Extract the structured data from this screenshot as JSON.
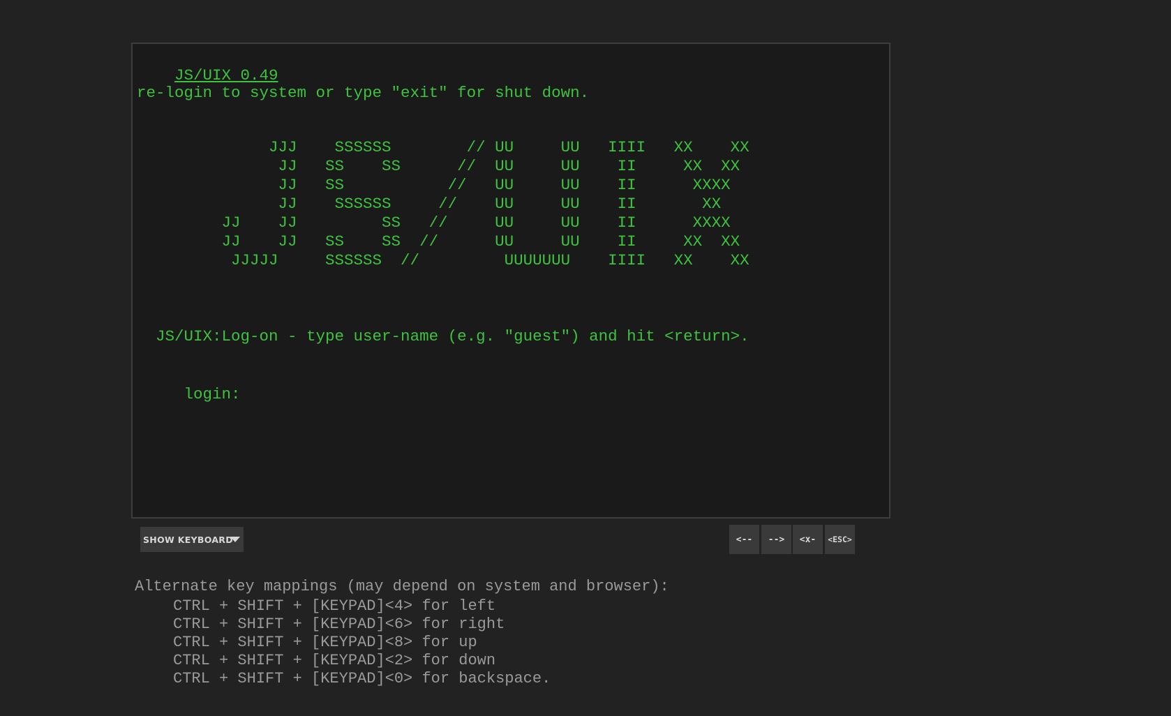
{
  "terminal": {
    "title": "JS/UIX 0.49",
    "relogin_message": "re-login to system or type \"exit\" for shut down.",
    "banner": [
      "              JJJ    SSSSSS        // UU     UU   IIII   XX    XX",
      "               JJ   SS    SS      //  UU     UU    II     XX  XX",
      "               JJ   SS           //   UU     UU    II      XXXX",
      "               JJ    SSSSSS     //    UU     UU    II       XX",
      "         JJ    JJ         SS   //     UU     UU    II      XXXX",
      "         JJ    JJ   SS    SS  //      UU     UU    II     XX  XX",
      "          JJJJJ     SSSSSS  //         UUUUUUU    IIII   XX    XX"
    ],
    "logon_hint": "  JS/UIX:Log-on - type user-name (e.g. \"guest\") and hit <return>.",
    "login_prompt": " login:"
  },
  "controls": {
    "show_keyboard_label": "SHOW KEYBOARD",
    "keys": {
      "left": "<--",
      "right": "-->",
      "backspace": "<x-",
      "escape": "<ESC>"
    }
  },
  "notes": {
    "heading": "Alternate key mappings (may depend on system and browser):",
    "mappings": [
      "CTRL + SHIFT + [KEYPAD]<4> for left",
      "CTRL + SHIFT + [KEYPAD]<6> for right",
      "CTRL + SHIFT + [KEYPAD]<8> for up",
      "CTRL + SHIFT + [KEYPAD]<2> for down",
      "CTRL + SHIFT + [KEYPAD]<0> for backspace."
    ]
  },
  "colors": {
    "page_background": "#222222",
    "terminal_background": "#1a1a1a",
    "terminal_text": "#3ec33e",
    "button_background": "#3a3a3a",
    "notes_text": "#9a9a9a"
  }
}
